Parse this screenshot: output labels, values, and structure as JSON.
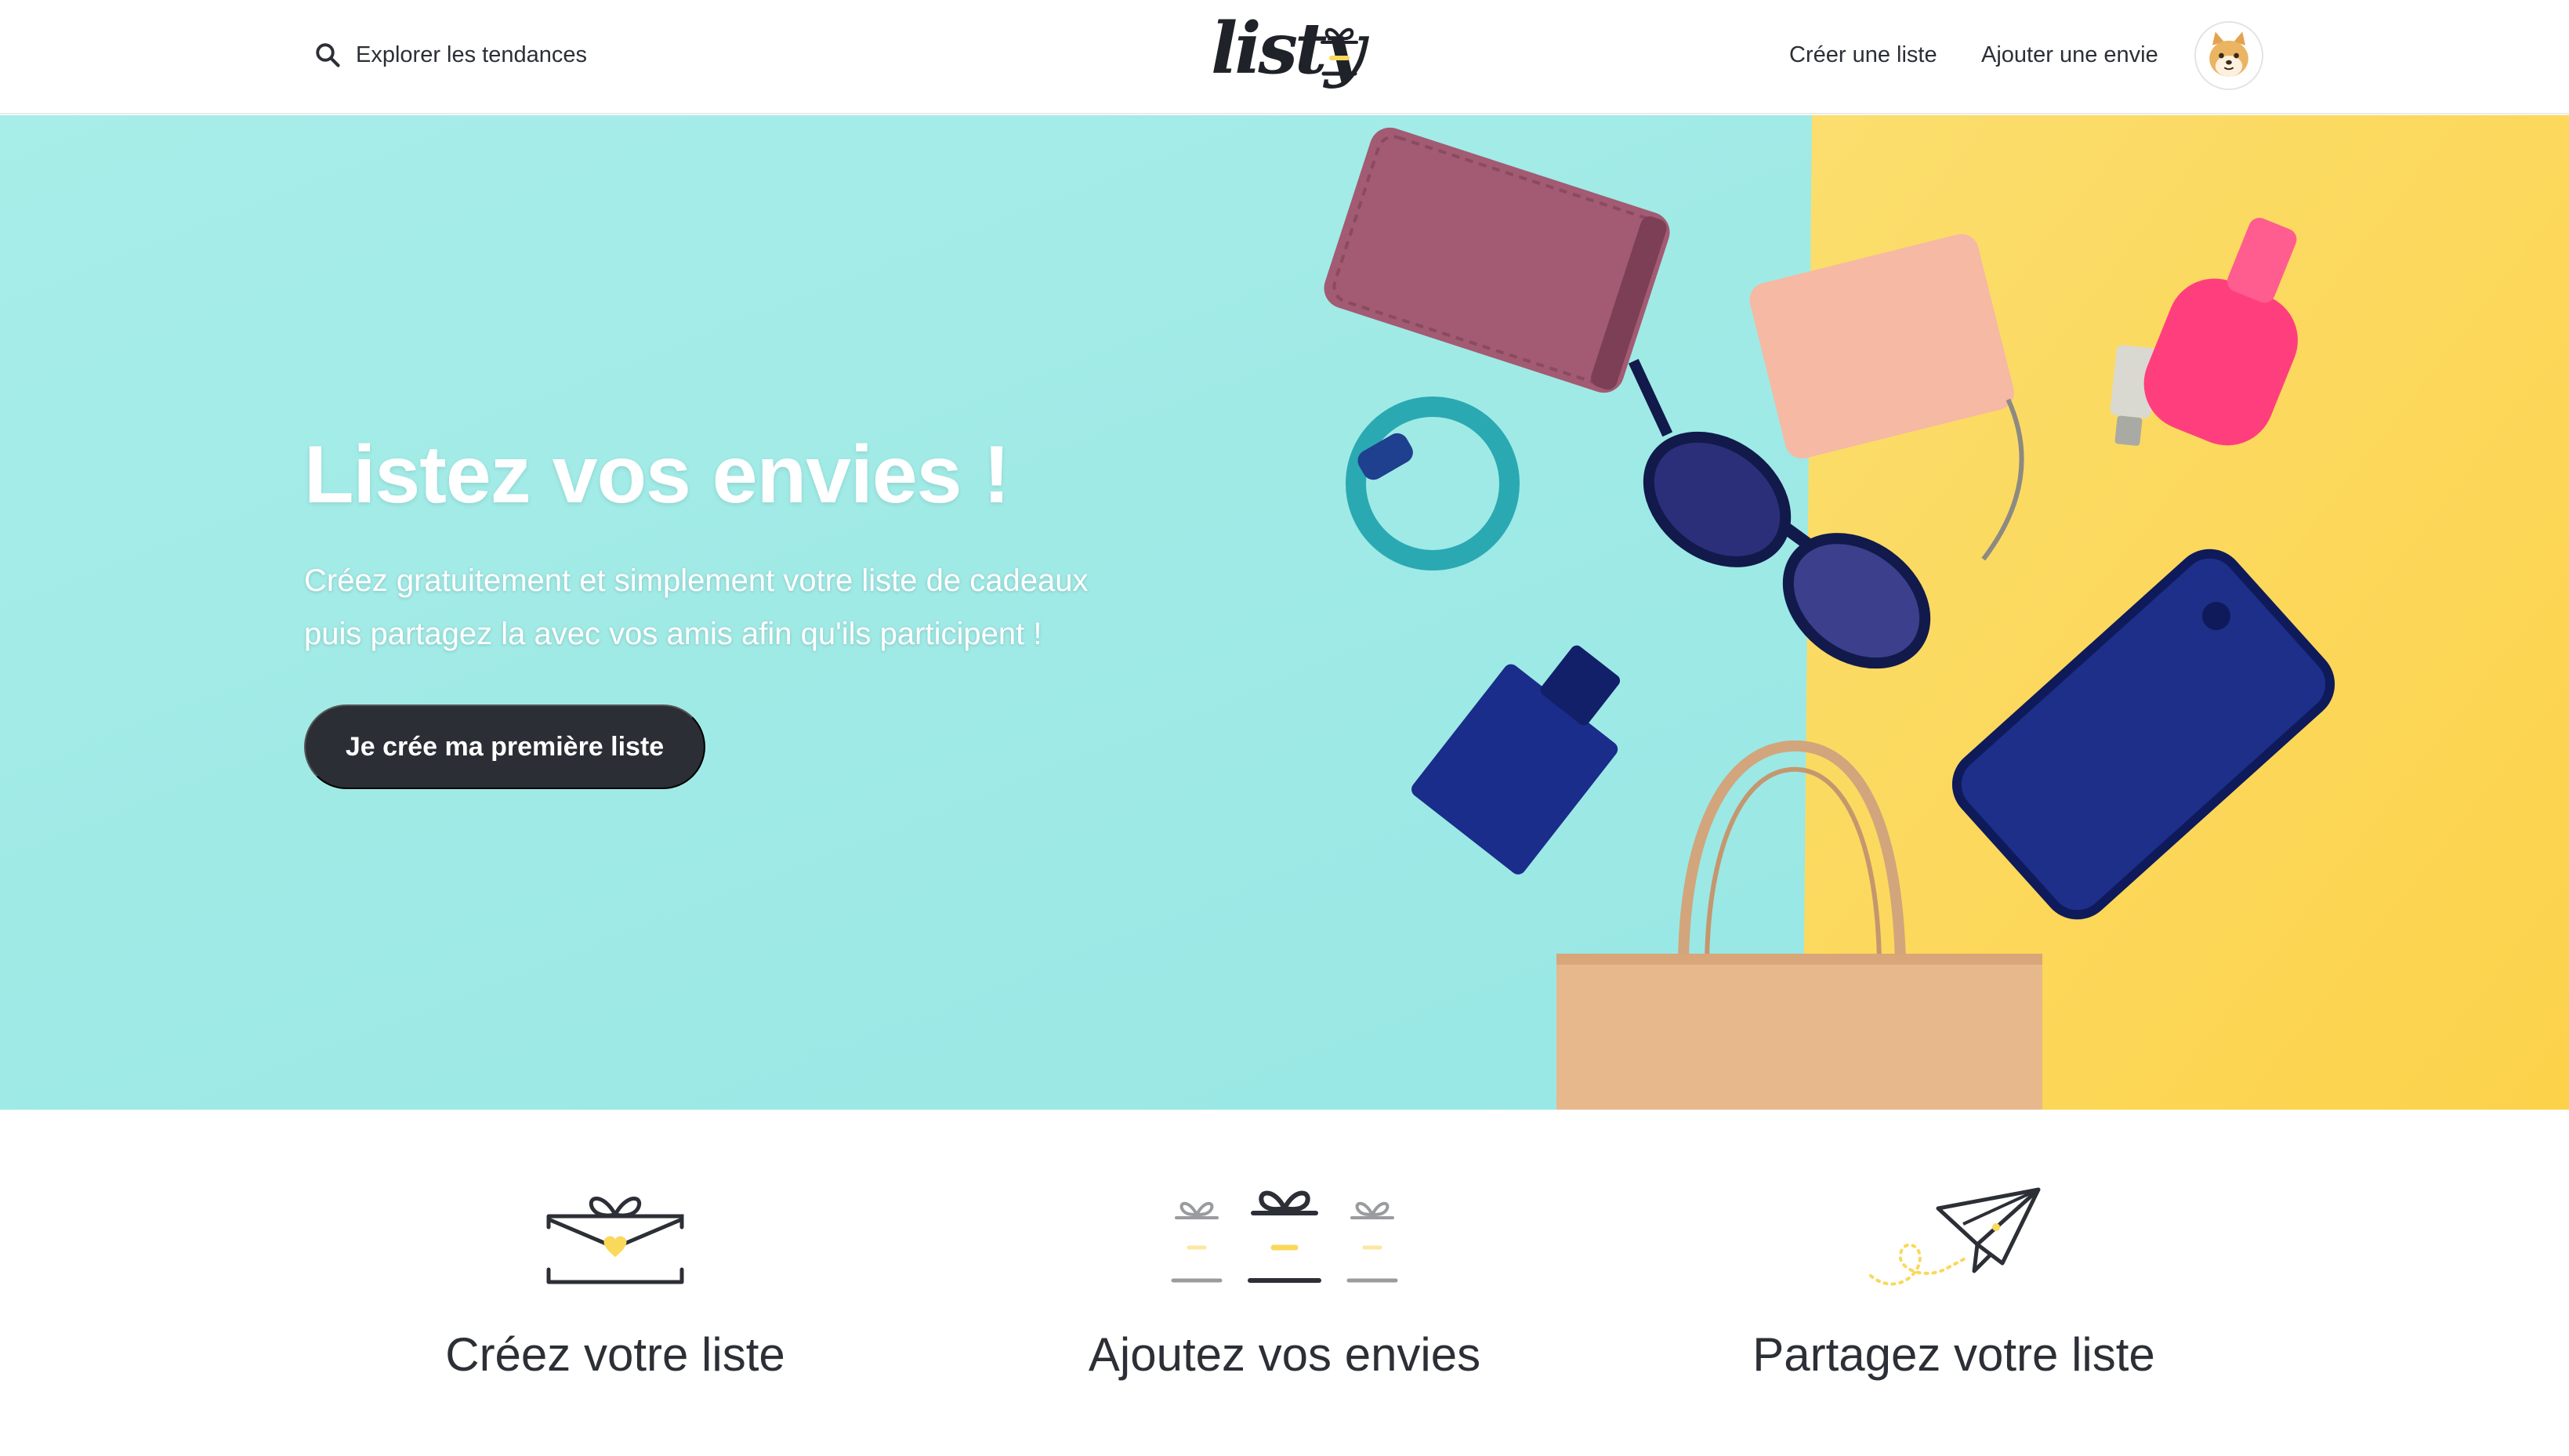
{
  "header": {
    "explore_label": "Explorer les tendances",
    "logo_text": "listy",
    "nav": {
      "create_list": "Créer une liste",
      "add_wish": "Ajouter une envie"
    }
  },
  "hero": {
    "title": "Listez vos envies !",
    "subtitle_line1": "Créez gratuitement et simplement votre liste de cadeaux",
    "subtitle_line2": "puis partagez la avec vos amis afin qu'ils participent !",
    "cta_label": "Je crée ma première liste"
  },
  "features": [
    {
      "icon": "envelope-gift-icon",
      "title": "Créez votre liste"
    },
    {
      "icon": "gifts-icon",
      "title": "Ajoutez vos envies"
    },
    {
      "icon": "paper-plane-icon",
      "title": "Partagez votre liste"
    }
  ],
  "colors": {
    "accent_yellow": "#fad85a",
    "hero_teal": "#a1ece6",
    "dark": "#2b2e34"
  }
}
